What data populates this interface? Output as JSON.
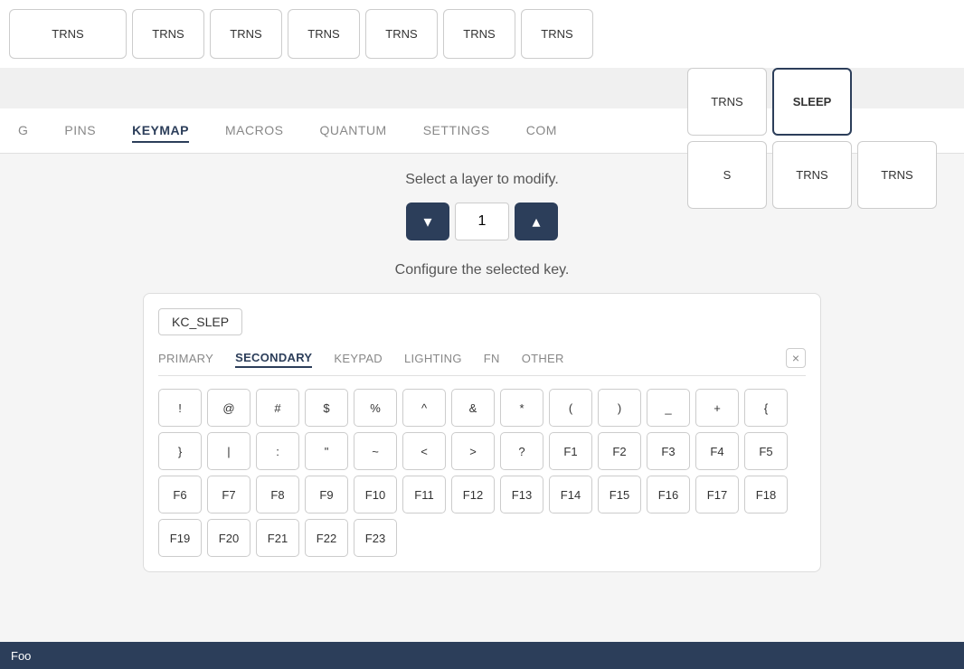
{
  "topKeys": [
    {
      "label": "TRNS",
      "selected": false
    },
    {
      "label": "TRNS",
      "selected": false
    },
    {
      "label": "TRNS",
      "selected": false
    },
    {
      "label": "TRNS",
      "selected": false
    },
    {
      "label": "TRNS",
      "selected": false
    },
    {
      "label": "TRNS",
      "selected": false
    },
    {
      "label": "TRNS",
      "selected": false
    }
  ],
  "floatingKeys": [
    [
      {
        "label": "TRNS",
        "selected": false
      },
      {
        "label": "SLEEP",
        "selected": true
      }
    ],
    [
      {
        "label": "S",
        "selected": false
      },
      {
        "label": "TRNS",
        "selected": false
      },
      {
        "label": "TRNS",
        "selected": false
      }
    ]
  ],
  "navTabs": [
    {
      "label": "G",
      "active": false
    },
    {
      "label": "PINS",
      "active": false
    },
    {
      "label": "KEYMAP",
      "active": true
    },
    {
      "label": "MACROS",
      "active": false
    },
    {
      "label": "QUANTUM",
      "active": false
    },
    {
      "label": "SETTINGS",
      "active": false
    },
    {
      "label": "COM",
      "active": false
    }
  ],
  "selectLayerText": "Select a layer to modify.",
  "layerValue": "1",
  "configureText": "Configure the selected key.",
  "keyCode": "KC_SLEP",
  "panelTabs": [
    {
      "label": "PRIMARY",
      "active": false
    },
    {
      "label": "SECONDARY",
      "active": true
    },
    {
      "label": "KEYPAD",
      "active": false
    },
    {
      "label": "LIGHTING",
      "active": false
    },
    {
      "label": "FN",
      "active": false
    },
    {
      "label": "OTHER",
      "active": false
    }
  ],
  "closeLabel": "×",
  "keyRows": [
    [
      "!",
      "@",
      "#",
      "$",
      "%",
      "^",
      "&",
      "*",
      "(",
      ")"
    ],
    [
      "_",
      "+",
      "{",
      "}",
      "|",
      ":",
      "\"",
      "~",
      "<",
      ">",
      "?"
    ],
    [
      "F1",
      "F2",
      "F3",
      "F4",
      "F5",
      "F6",
      "F7",
      "F8",
      "F9",
      "F10",
      "F11",
      "F12"
    ],
    [
      "F13",
      "F14",
      "F15",
      "F16",
      "F17",
      "F18",
      "F19",
      "F20",
      "F21",
      "F22",
      "F23"
    ]
  ],
  "bottomBar": {
    "text": "Foo"
  },
  "layerDownArrow": "▾",
  "layerUpArrow": "▴"
}
